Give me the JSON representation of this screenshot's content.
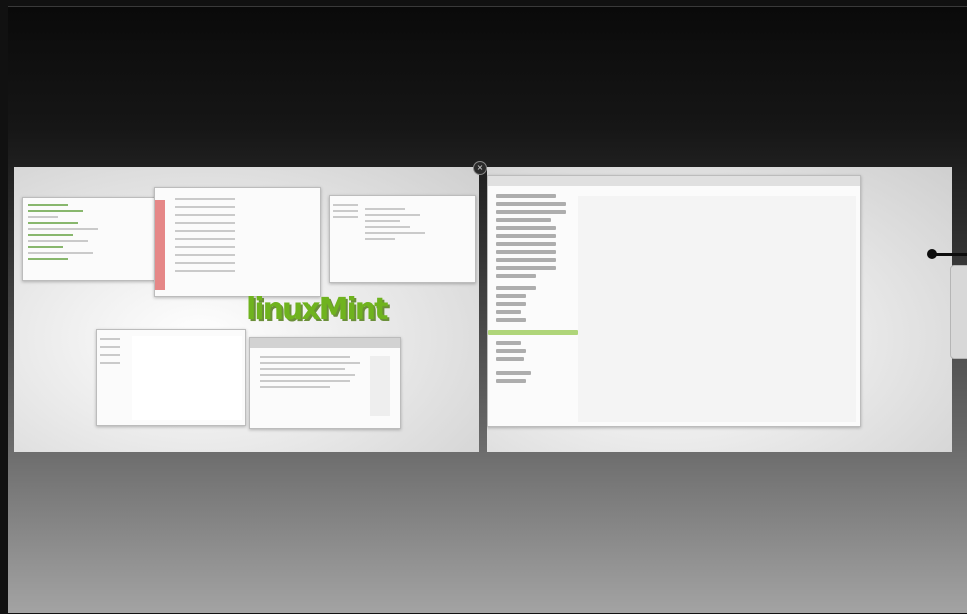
{
  "overview": {
    "workspaces": [
      {
        "name": "workspace-1",
        "selected": false
      },
      {
        "name": "workspace-2",
        "selected": true
      }
    ],
    "close_glyph": "×",
    "background_text": "linuxMint",
    "icons": [
      "close-icon",
      "navigation-pointer-icon"
    ]
  }
}
